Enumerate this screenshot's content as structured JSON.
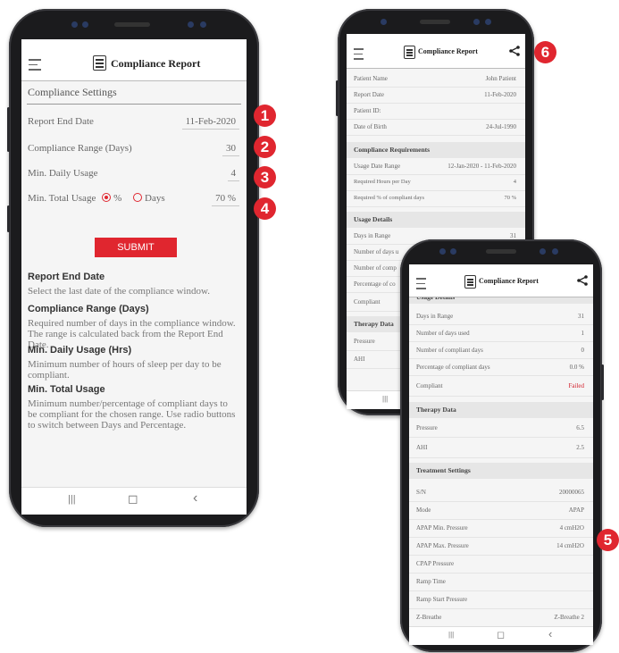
{
  "colors": {
    "accent": "#e0262f",
    "fail": "#d21f2b"
  },
  "icons": [
    "hamburger-menu-icon",
    "report-icon",
    "share-icon",
    "recent-apps-icon",
    "home-icon",
    "back-icon"
  ],
  "badges": [
    "1",
    "2",
    "3",
    "4",
    "5",
    "6"
  ],
  "app": {
    "title": "Compliance Report"
  },
  "nav": {
    "recent": "|||",
    "home": "◻",
    "back": "‹"
  },
  "settings_screen": {
    "heading": "Compliance Settings",
    "fields": [
      {
        "label": "Report End Date",
        "value": "11-Feb-2020"
      },
      {
        "label": "Compliance Range (Days)",
        "value": "30"
      },
      {
        "label": "Min. Daily Usage",
        "value": "4"
      }
    ],
    "total_usage": {
      "label": "Min. Total Usage",
      "option_percent": "%",
      "option_days": "Days",
      "value": "70 %"
    },
    "submit": "SUBMIT",
    "help": [
      {
        "title": "Report End Date",
        "text": "Select the last date of the compliance window."
      },
      {
        "title": "Compliance Range (Days)",
        "text": "Required number of days in the compliance window. The range is calculated back from the Report End Date."
      },
      {
        "title": "Min. Daily Usage (Hrs)",
        "text": "Minimum number of hours of sleep per day to be compliant."
      },
      {
        "title": "Min. Total Usage",
        "text": "Minimum number/percentage of compliant days to be compliant for the chosen range. Use radio buttons to switch between Days and Percentage."
      }
    ]
  },
  "report_screen": {
    "patient": [
      {
        "label": "Patient Name",
        "value": "John Patient"
      },
      {
        "label": "Report Date",
        "value": "11-Feb-2020"
      },
      {
        "label": "Patient ID:",
        "value": ""
      },
      {
        "label": "Date of Birth",
        "value": "24-Jul-1990"
      }
    ],
    "requirements_heading": "Compliance Requirements",
    "requirements": [
      {
        "label": "Usage Date Range",
        "value": "12-Jan-2020 - 11-Feb-2020"
      },
      {
        "label": "Required Hours per Day",
        "value": "4"
      },
      {
        "label": "Required % of compliant days",
        "value": "70 %"
      }
    ],
    "usage_heading": "Usage Details",
    "usage_partial": [
      {
        "label": "Days in Range",
        "value": "31"
      },
      {
        "label": "Number of days u",
        "value": ""
      },
      {
        "label": "Number of comp",
        "value": ""
      },
      {
        "label": "Percentage of co",
        "value": ""
      },
      {
        "label": "Compliant",
        "value": ""
      }
    ],
    "therapy_heading": "Therapy Data",
    "therapy_partial": [
      {
        "label": "Pressure",
        "value": ""
      },
      {
        "label": "AHI",
        "value": ""
      }
    ]
  },
  "detail_screen": {
    "usage_heading": "Usage Details",
    "usage": [
      {
        "label": "Days in Range",
        "value": "31"
      },
      {
        "label": "Number of days used",
        "value": "1"
      },
      {
        "label": "Number of compliant days",
        "value": "0"
      },
      {
        "label": "Percentage of compliant days",
        "value": "0.0 %"
      },
      {
        "label": "Compliant",
        "value": "Failed"
      }
    ],
    "therapy_heading": "Therapy Data",
    "therapy": [
      {
        "label": "Pressure",
        "value": "6.5"
      },
      {
        "label": "AHI",
        "value": "2.5"
      }
    ],
    "treatment_heading": "Treatment Settings",
    "treatment": [
      {
        "label": "S/N",
        "value": "20000065"
      },
      {
        "label": "Mode",
        "value": "APAP"
      },
      {
        "label": "APAP Min. Pressure",
        "value": "4 cmH2O"
      },
      {
        "label": "APAP Max. Pressure",
        "value": "14 cmH2O"
      },
      {
        "label": "CPAP Pressure",
        "value": ""
      },
      {
        "label": "Ramp Time",
        "value": ""
      },
      {
        "label": "Ramp Start Pressure",
        "value": ""
      },
      {
        "label": "Z-Breathe",
        "value": "Z-Breathe 2"
      }
    ]
  }
}
